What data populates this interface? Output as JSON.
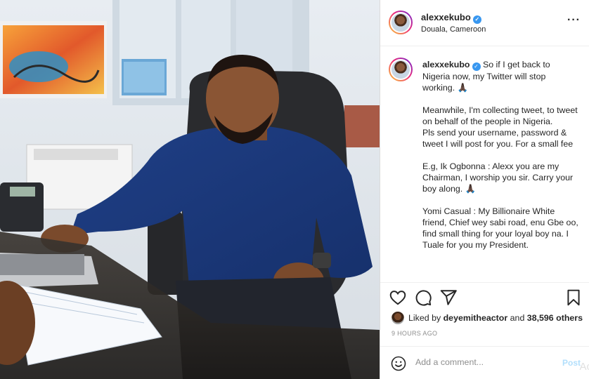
{
  "post": {
    "username": "alexxekubo",
    "location": "Douala, Cameroon",
    "more_icon": "more-options-icon",
    "caption_paragraphs": [
      "So if I get back to Nigeria now, my Twitter will stop working. 🙏🏿",
      "Meanwhile, I'm collecting tweet, to tweet on behalf of the people in Nigeria.",
      "Pls send your username, password & tweet I will post for you. For a small fee",
      "E.g, Ik Ogbonna : Alexx you are my Chairman, I worship you sir. Carry your boy along. 🙏🏿",
      "Yomi Casual : My Billionaire White friend, Chief wey sabi road, enu Gbe oo, find small thing for your loyal boy na. I Tuale for you my President."
    ],
    "likes": {
      "prefix": "Liked by",
      "liker": "deyemitheactor",
      "connector": "and",
      "others": "38,596 others"
    },
    "time_ago": "9 HOURS AGO"
  },
  "actions": {
    "icons": [
      "heart-icon",
      "comment-icon",
      "share-icon",
      "bookmark-icon"
    ]
  },
  "comment": {
    "placeholder": "Add a comment...",
    "post_label": "Post",
    "overlay_text": "Ac"
  },
  "colors": {
    "verified_blue": "#3897f0",
    "post_disabled": "#b2dffc",
    "muted_text": "#8e8e8e"
  }
}
